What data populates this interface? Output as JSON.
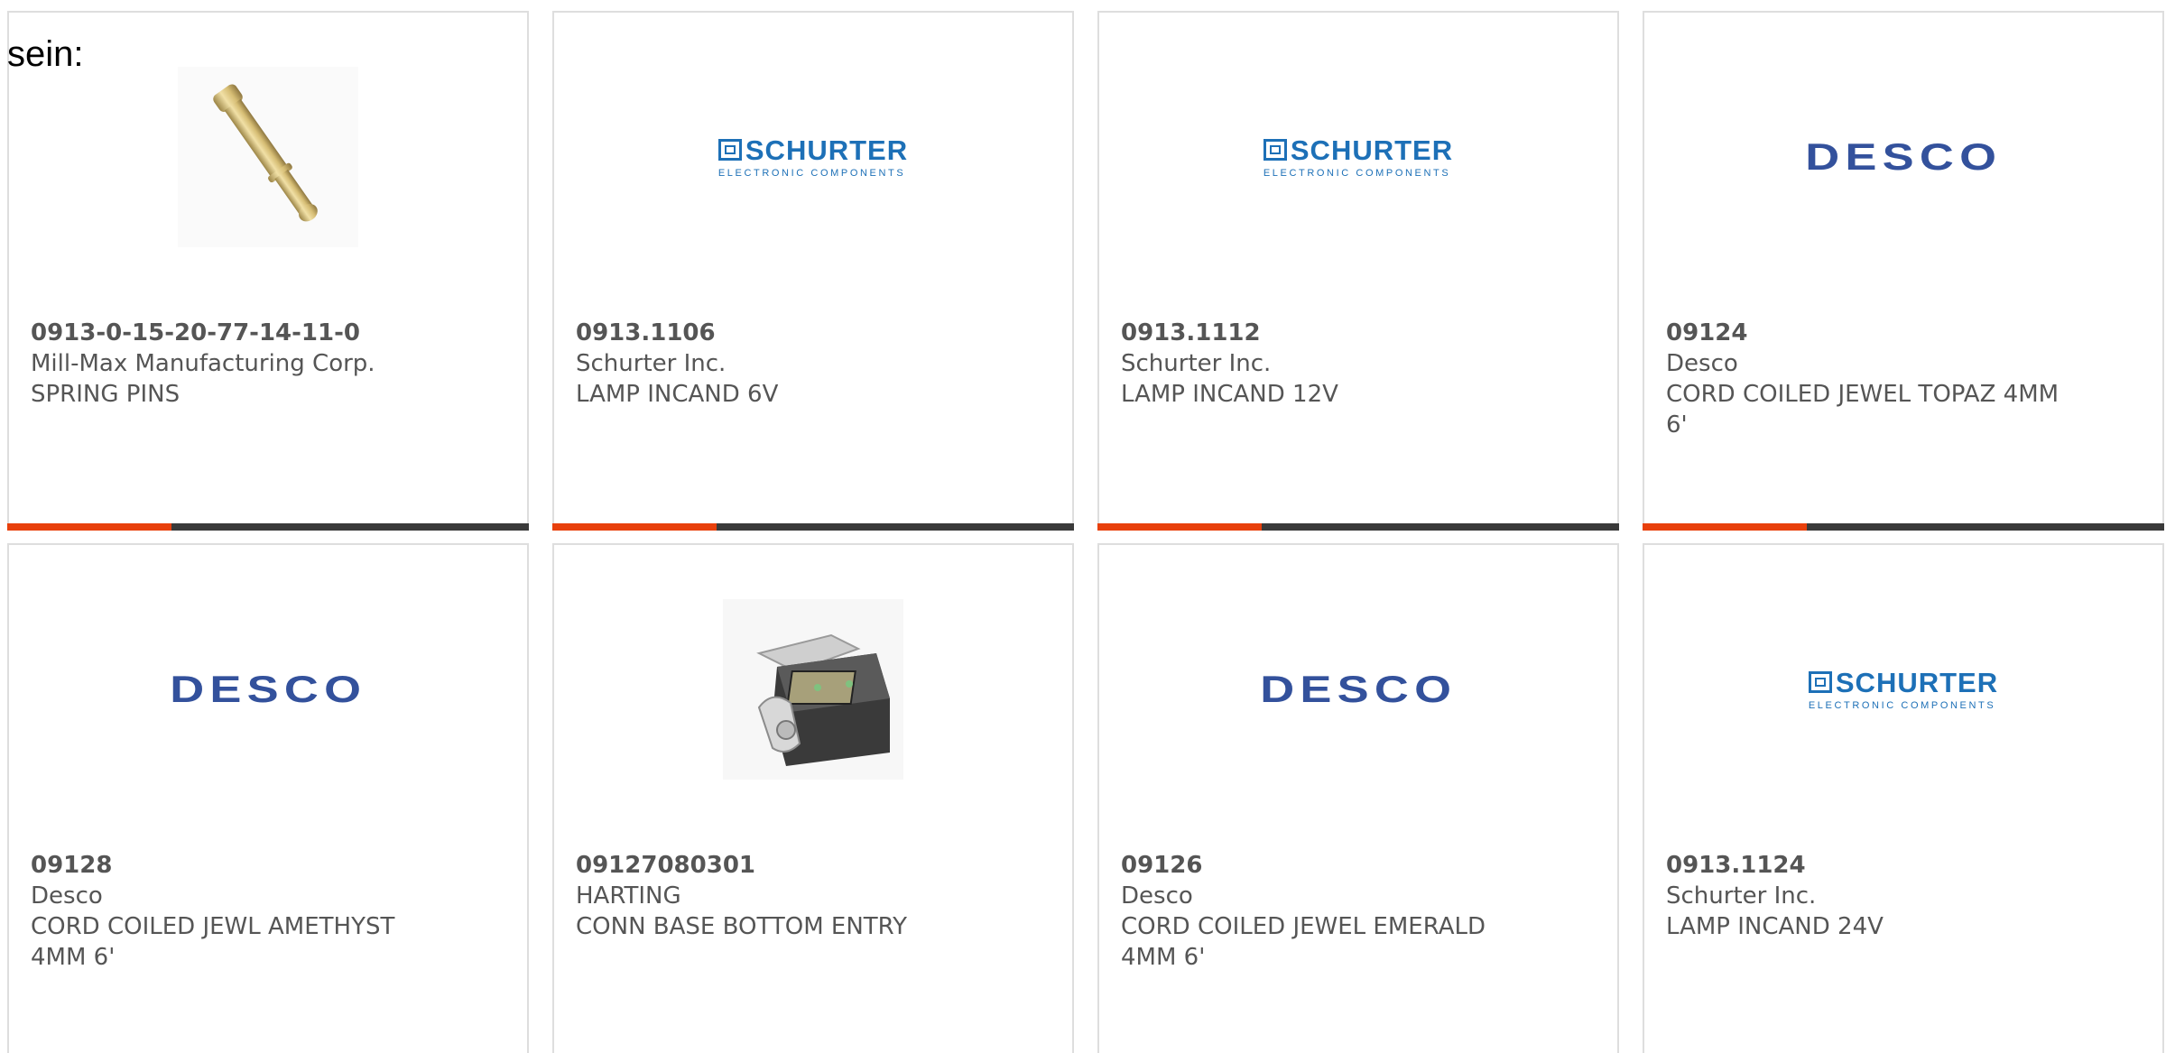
{
  "intro_text": "sein:",
  "products": [
    {
      "part_number": "0913-0-15-20-77-14-11-0",
      "manufacturer": "Mill-Max Manufacturing Corp.",
      "description": "SPRING PINS",
      "image": "spring-pin-photo"
    },
    {
      "part_number": "0913.1106",
      "manufacturer": "Schurter Inc.",
      "description": "LAMP INCAND 6V",
      "image": "schurter-logo"
    },
    {
      "part_number": "0913.1112",
      "manufacturer": "Schurter Inc.",
      "description": "LAMP INCAND 12V",
      "image": "schurter-logo"
    },
    {
      "part_number": "09124",
      "manufacturer": "Desco",
      "description": "CORD COILED JEWEL TOPAZ 4MM 6'",
      "image": "desco-logo"
    },
    {
      "part_number": "09128",
      "manufacturer": "Desco",
      "description": "CORD COILED JEWL AMETHYST 4MM 6'",
      "image": "desco-logo"
    },
    {
      "part_number": "09127080301",
      "manufacturer": "HARTING",
      "description": "CONN BASE BOTTOM ENTRY",
      "image": "connector-housing-photo"
    },
    {
      "part_number": "09126",
      "manufacturer": "Desco",
      "description": "CORD COILED JEWEL EMERALD 4MM 6'",
      "image": "desco-logo"
    },
    {
      "part_number": "0913.1124",
      "manufacturer": "Schurter Inc.",
      "description": "LAMP INCAND 24V",
      "image": "schurter-logo"
    }
  ],
  "logos": {
    "schurter": {
      "name": "SCHURTER",
      "tagline": "ELECTRONIC COMPONENTS"
    },
    "desco": {
      "name": "DESCO"
    }
  },
  "colors": {
    "accent": "#e8400c",
    "bar": "#3a3a3a",
    "schurter_blue": "#1d70b7",
    "desco_blue": "#33519c",
    "text": "#555555"
  }
}
